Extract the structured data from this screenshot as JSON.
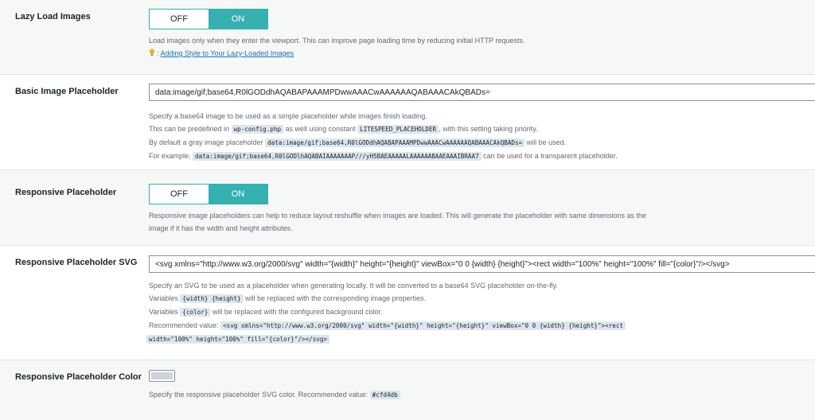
{
  "lazy_load": {
    "label": "Lazy Load Images",
    "off_label": "OFF",
    "on_label": "ON",
    "desc": "Load images only when they enter the viewport. This can improve page loading time by reducing initial HTTP requests.",
    "link_text": "Adding Style to Your Lazy-Loaded Images"
  },
  "basic_placeholder": {
    "label": "Basic Image Placeholder",
    "value": "data:image/gif;base64,R0lGODdhAQABAPAAAMPDwwAAACwAAAAAAQABAAACAkQBADs=",
    "line1": "Specify a base64 image to be used as a simple placeholder while images finish loading.",
    "line2_pre": "This can be predefined in",
    "line2_code1": "wp-config.php",
    "line2_mid": "as well using constant",
    "line2_code2": "LITESPEED_PLACEHOLDER",
    "line2_post": ", with this setting taking priority.",
    "line3_pre": "By default a gray image placeholder",
    "line3_code": "data:image/gif;base64,R0lGODdhAQABAPAAAMPDwwAAACwAAAAAAQABAAACAkQBADs=",
    "line3_post": "will be used.",
    "line4_pre": "For example,",
    "line4_code": "data:image/gif;base64,R0lGODlhAQABAIAAAAAAAP///yH5BAEAAAAALAAAAAABAAEAAAIBRAA7",
    "line4_post": "can be used for a transparent placeholder."
  },
  "responsive_placeholder": {
    "label": "Responsive Placeholder",
    "off_label": "OFF",
    "on_label": "ON",
    "desc_line1": "Responsive image placeholders can help to reduce layout reshuffle when images are loaded. This will generate the placeholder with same dimensions as the",
    "desc_line2": "image if it has the width and height attributes."
  },
  "placeholder_svg": {
    "label": "Responsive Placeholder SVG",
    "value": "<svg xmlns=\"http://www.w3.org/2000/svg\" width=\"{width}\" height=\"{height}\" viewBox=\"0 0 {width} {height}\"><rect width=\"100%\" height=\"100%\" fill=\"{color}\"/></svg>",
    "line1": "Specify an SVG to be used as a placeholder when generating locally. It will be converted to a base64 SVG placeholder on-the-fly.",
    "line2_pre": "Variables",
    "line2_code": "{width} {height}",
    "line2_post": "will be replaced with the corresponding image properties.",
    "line3_pre": "Variables",
    "line3_code": "{color}",
    "line3_post": "will be replaced with the configured background color.",
    "line4_pre": "Recommended value:",
    "line4_code_a": "<svg xmlns=\"http://www.w3.org/2000/svg\" width=\"{width}\" height=\"{height}\" viewBox=\"0 0 {width} {height}\"><rect",
    "line4_code_b": "width=\"100%\" height=\"100%\" fill=\"{color}\"/></svg>"
  },
  "placeholder_color": {
    "label": "Responsive Placeholder Color",
    "swatch_color": "#cfd4db",
    "desc_pre": "Specify the responsive placeholder SVG color. Recommended value:",
    "desc_code": "#cfd4db"
  },
  "colors": {
    "toggle_on": "#36b0b0",
    "code_bg": "#dde6ee",
    "link": "#2271b1"
  }
}
